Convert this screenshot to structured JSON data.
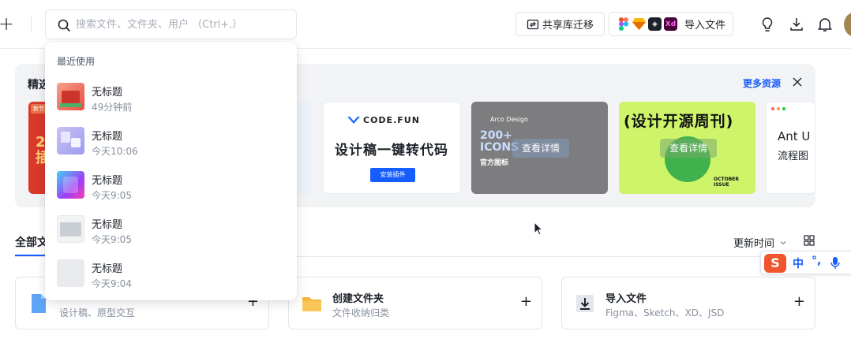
{
  "topbar": {
    "search_placeholder": "搜索文件、文件夹、用户 （Ctrl+.）",
    "migrate_label": "共享库迁移",
    "import_label": "导入文件",
    "import_apps": [
      "figma",
      "sketch",
      "axure",
      "xd"
    ]
  },
  "banner": {
    "title": "精选",
    "more_label": "更多资源",
    "cards": {
      "red": {
        "tag": "新节",
        "big": "2\n插"
      },
      "codefun": {
        "logo": "CODE.FUN",
        "headline": "设计稿一键转代码",
        "cta": "安装插件"
      },
      "arco": {
        "brand": "Arco Design",
        "num": "200+\nICONS",
        "sub": "官方图标",
        "hover": "查看详情"
      },
      "weekly": {
        "headline": "(设计开源周刊)",
        "issue": "OCTOBER ISSUE",
        "hover": "查看详情"
      },
      "ant": {
        "t1": "Ant U",
        "t2": "流程图"
      }
    }
  },
  "tabs": {
    "all_label": "全部文",
    "sort_label": "更新时间"
  },
  "quick": [
    {
      "title": "",
      "desc": "设计稿、原型交互"
    },
    {
      "title": "创建文件夹",
      "desc": "文件收纳归类"
    },
    {
      "title": "导入文件",
      "desc": "Figma、Sketch、XD、JSD"
    }
  ],
  "recent": {
    "title": "最近使用",
    "items": [
      {
        "name": "无标题",
        "time": "49分钟前"
      },
      {
        "name": "无标题",
        "time": "今天10:06"
      },
      {
        "name": "无标题",
        "time": "今天9:05"
      },
      {
        "name": "无标题",
        "time": "今天9:05"
      },
      {
        "name": "无标题",
        "time": "今天9:04"
      }
    ]
  },
  "ime": {
    "logo": "S",
    "lang": "中",
    "punct": "°,"
  },
  "colors": {
    "accent": "#165dff",
    "brand_ime": "#f0562c"
  }
}
